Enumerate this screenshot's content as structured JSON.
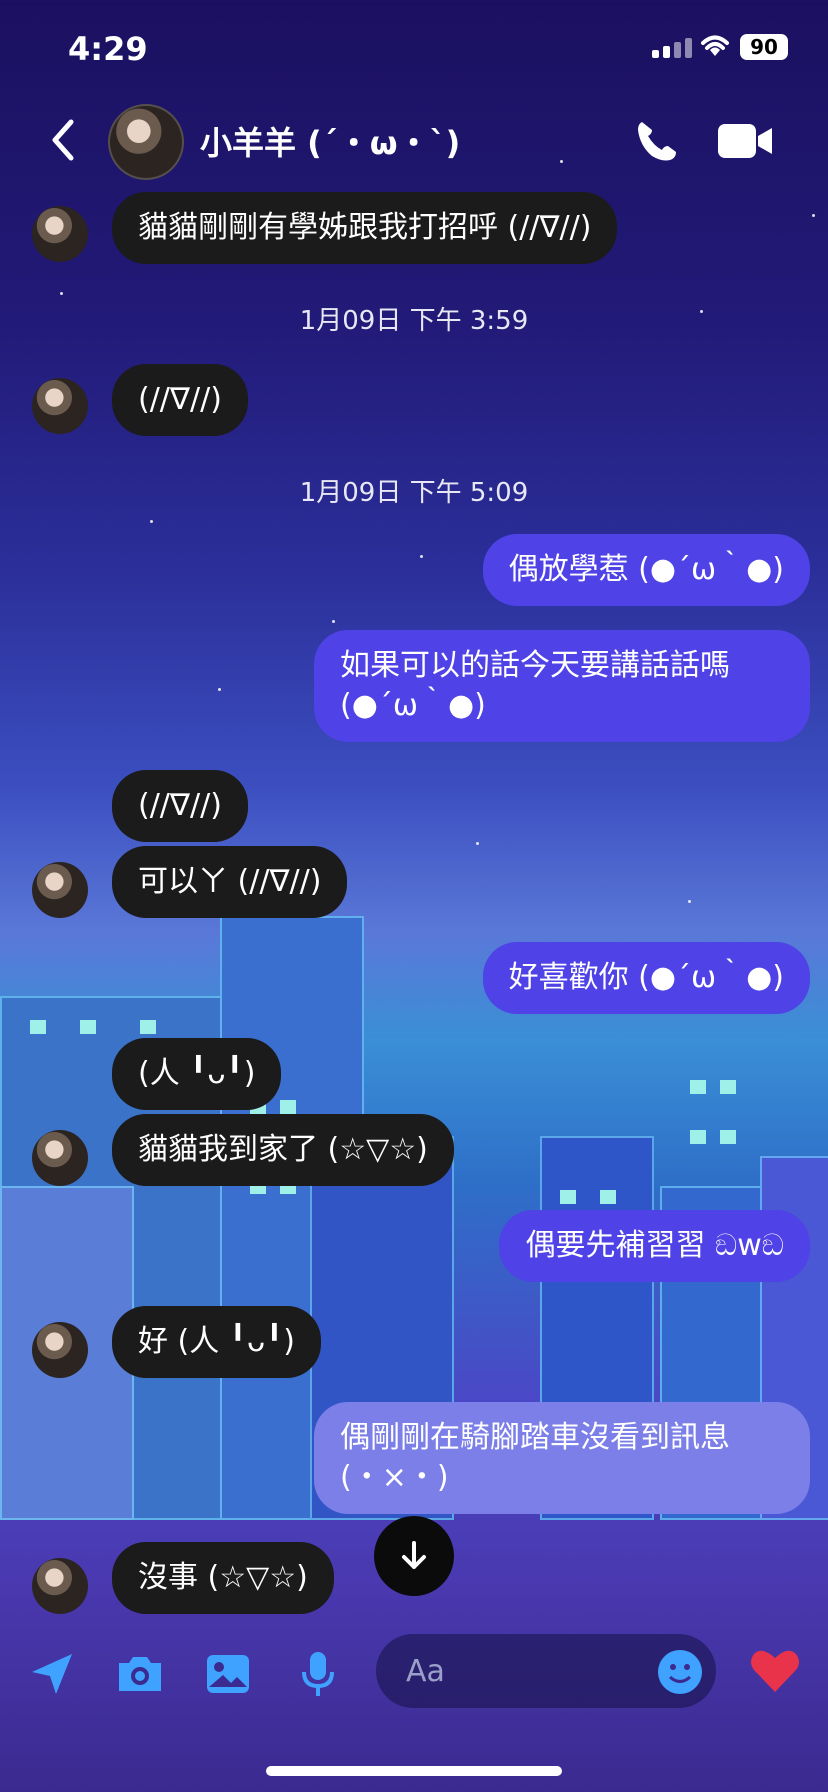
{
  "status": {
    "time": "4:29",
    "battery": "90"
  },
  "header": {
    "contact_name": "小羊羊 (´・ω・`)"
  },
  "messages": [
    {
      "dir": "in",
      "text": "貓貓剛剛有學姊跟我打招呼 (//∇//)"
    },
    {
      "timestamp": "1月09日 下午 3:59"
    },
    {
      "dir": "in",
      "text": "(//∇//)"
    },
    {
      "timestamp": "1月09日 下午 5:09"
    },
    {
      "dir": "out",
      "text": "偶放學惹 (●´ω｀●)"
    },
    {
      "dir": "out",
      "text": "如果可以的話今天要講話話嗎\n(●´ω｀●)"
    },
    {
      "dir": "in",
      "text": "(//∇//)"
    },
    {
      "dir": "in",
      "text": "可以ㄚ (//∇//)"
    },
    {
      "dir": "out",
      "text": "好喜歡你 (●´ω｀●)"
    },
    {
      "dir": "in",
      "text": "(人 ╹ᴗ╹)"
    },
    {
      "dir": "in",
      "text": "貓貓我到家了 (☆▽☆)"
    },
    {
      "dir": "out",
      "text": "偶要先補習習 ඞwඞ"
    },
    {
      "dir": "in",
      "text": "好 (人 ╹ᴗ╹)"
    },
    {
      "dir": "out",
      "text": "偶剛剛在騎腳踏車沒看到訊息\n(・×・)"
    },
    {
      "dir": "in",
      "text": "沒事 (☆▽☆)"
    }
  ],
  "composer": {
    "placeholder": "Aa"
  }
}
